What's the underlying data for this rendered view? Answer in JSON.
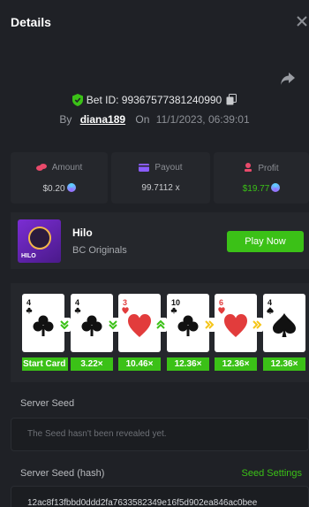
{
  "header": {
    "title": "Details"
  },
  "bet": {
    "id_label": "Bet ID: 99367577381240990",
    "by_label": "By",
    "user": "diana189",
    "on_label": "On",
    "date": "11/1/2023, 06:39:01"
  },
  "stats": {
    "amount": {
      "label": "Amount",
      "value": "$0.20",
      "icon": "coins-icon",
      "color": "#e94a6b"
    },
    "payout": {
      "label": "Payout",
      "value": "99.7112 x",
      "icon": "wallet-icon",
      "color": "#8a5cff"
    },
    "profit": {
      "label": "Profit",
      "value": "$19.77",
      "icon": "profit-icon",
      "color": "#e94a6b",
      "value_color": "#3bc117"
    }
  },
  "game": {
    "name": "Hilo",
    "provider": "BC Originals",
    "thumb_text": "HILO",
    "play_label": "Play Now"
  },
  "cards": [
    {
      "rank": "4",
      "suit": "club",
      "color": "#111111",
      "multiplier": "Start Card",
      "arrow": "double-chevron-down",
      "arrow_color": "#3bc117"
    },
    {
      "rank": "4",
      "suit": "club",
      "color": "#111111",
      "multiplier": "3.22×",
      "arrow": "double-chevron-down",
      "arrow_color": "#3bc117"
    },
    {
      "rank": "3",
      "suit": "heart",
      "color": "#e23c3c",
      "multiplier": "10.46×",
      "arrow": "double-chevron-up",
      "arrow_color": "#3bc117"
    },
    {
      "rank": "10",
      "suit": "club",
      "color": "#111111",
      "multiplier": "12.36×",
      "arrow": "double-chevron-right",
      "arrow_color": "#f5c518"
    },
    {
      "rank": "6",
      "suit": "heart",
      "color": "#e23c3c",
      "multiplier": "12.36×",
      "arrow": "double-chevron-right",
      "arrow_color": "#f5c518"
    },
    {
      "rank": "4",
      "suit": "spade",
      "color": "#111111",
      "multiplier": "12.36×",
      "arrow": "",
      "arrow_color": ""
    }
  ],
  "seeds": {
    "server_seed_label": "Server Seed",
    "server_seed_value": "The Seed hasn't been revealed yet.",
    "server_hash_label": "Server Seed (hash)",
    "seed_settings_label": "Seed Settings",
    "server_hash_value": "12ac8f13fbbd0ddd2fa7633582349e16f5d902ea846ac0bee"
  },
  "colors": {
    "accent": "#3bc117",
    "panel": "#25272c",
    "background": "#1f2126"
  }
}
